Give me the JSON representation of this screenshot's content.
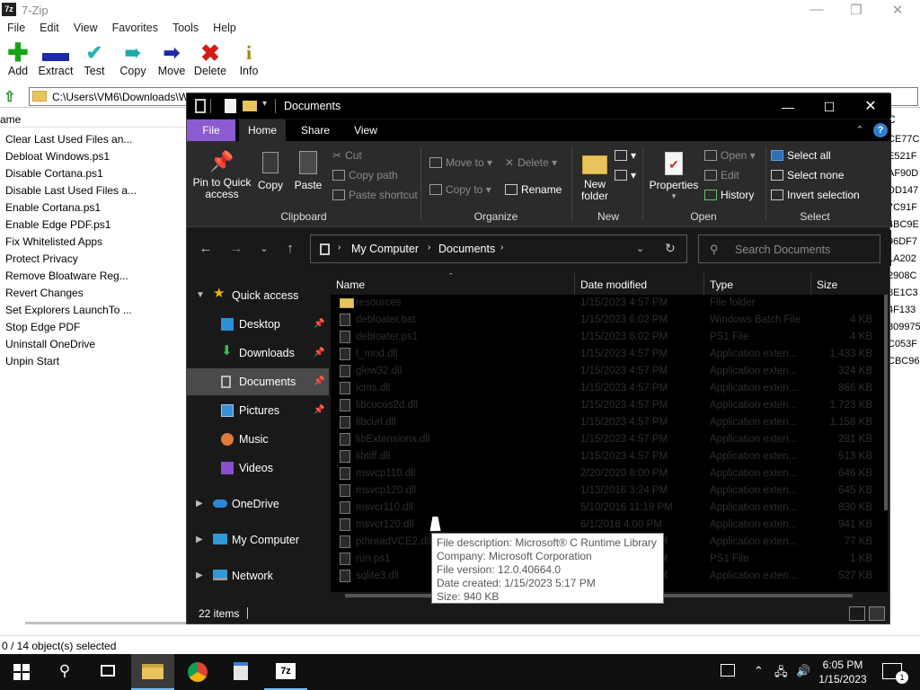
{
  "zip": {
    "title": "7-Zip",
    "menu": [
      "File",
      "Edit",
      "View",
      "Favorites",
      "Tools",
      "Help"
    ],
    "toolbar": [
      {
        "label": "Add",
        "icon": "plus-icon",
        "color": "#17a317"
      },
      {
        "label": "Extract",
        "icon": "minus-icon",
        "color": "#1a2aa8"
      },
      {
        "label": "Test",
        "icon": "check-icon",
        "color": "#1fb5b5"
      },
      {
        "label": "Copy",
        "icon": "double-arrow-icon",
        "color": "#1aa8a8"
      },
      {
        "label": "Move",
        "icon": "arrow-right-icon",
        "color": "#1a2aa8"
      },
      {
        "label": "Delete",
        "icon": "x-icon",
        "color": "#d41a1a"
      },
      {
        "label": "Info",
        "icon": "info-icon",
        "color": "#a08a10"
      }
    ],
    "address": "C:\\Users\\VM6\\Downloads\\W",
    "column_name": "ame",
    "files": [
      "Clear Last Used Files an...",
      "Debloat Windows.ps1",
      "Disable Cortana.ps1",
      "Disable Last Used Files a...",
      "Enable Cortana.ps1",
      "Enable Edge PDF.ps1",
      "Fix Whitelisted Apps",
      "Protect Privacy",
      "Remove Bloatware Reg...",
      "Revert Changes",
      "Set Explorers LaunchTo ...",
      "Stop Edge PDF",
      "Uninstall OneDrive",
      "Unpin Start"
    ],
    "right_col_header": "C",
    "right_col": [
      "CE77C",
      "E521F",
      "AF90D",
      "DD147",
      "7C91F",
      "4BC9E",
      "96DF7",
      "1A202",
      "2908C",
      "8E1C3",
      "4F133",
      "309975",
      "C053F",
      "CBC96"
    ],
    "status": "0 / 14 object(s) selected"
  },
  "explorer": {
    "title": "Documents",
    "tabs": [
      "File",
      "Home",
      "Share",
      "View"
    ],
    "ribbon": {
      "pin": "Pin to Quick access",
      "copy": "Copy",
      "paste": "Paste",
      "cut": "Cut",
      "copy_path": "Copy path",
      "paste_shortcut": "Paste shortcut",
      "clipboard": "Clipboard",
      "move_to": "Move to",
      "copy_to": "Copy to",
      "delete": "Delete",
      "rename": "Rename",
      "organize": "Organize",
      "new_folder": "New folder",
      "new": "New",
      "properties": "Properties",
      "open": "Open",
      "edit": "Edit",
      "history": "History",
      "open_group": "Open",
      "select_all": "Select all",
      "select_none": "Select none",
      "invert": "Invert selection",
      "select": "Select"
    },
    "breadcrumb": [
      "My Computer",
      "Documents"
    ],
    "search_placeholder": "Search Documents",
    "nav": [
      {
        "label": "Quick access",
        "icon": "star-icon"
      },
      {
        "label": "Desktop",
        "icon": "desktop-icon"
      },
      {
        "label": "Downloads",
        "icon": "download-icon"
      },
      {
        "label": "Documents",
        "icon": "documents-icon"
      },
      {
        "label": "Pictures",
        "icon": "pictures-icon"
      },
      {
        "label": "Music",
        "icon": "music-icon"
      },
      {
        "label": "Videos",
        "icon": "videos-icon"
      },
      {
        "label": "OneDrive",
        "icon": "cloud-icon"
      },
      {
        "label": "My Computer",
        "icon": "computer-icon"
      },
      {
        "label": "Network",
        "icon": "network-icon"
      }
    ],
    "columns": [
      "Name",
      "Date modified",
      "Type",
      "Size"
    ],
    "files": [
      {
        "name": "resources",
        "date": "1/15/2023 4:57 PM",
        "type": "File folder",
        "size": "",
        "folder": true
      },
      {
        "name": "debloater.bat",
        "date": "1/15/2023 6:02 PM",
        "type": "Windows Batch File",
        "size": "4 KB"
      },
      {
        "name": "debloater.ps1",
        "date": "1/15/2023 6:02 PM",
        "type": "PS1 File",
        "size": "4 KB"
      },
      {
        "name": "f_mod.dll",
        "date": "1/15/2023 4:57 PM",
        "type": "Application exten...",
        "size": "1,433 KB"
      },
      {
        "name": "glew32.dll",
        "date": "1/15/2023 4:57 PM",
        "type": "Application exten...",
        "size": "324 KB"
      },
      {
        "name": "lcms.dll",
        "date": "1/15/2023 4:57 PM",
        "type": "Application exten...",
        "size": "866 KB"
      },
      {
        "name": "libcocos2d.dll",
        "date": "1/15/2023 4:57 PM",
        "type": "Application exten...",
        "size": "1,723 KB"
      },
      {
        "name": "libcurl.dll",
        "date": "1/15/2023 4:57 PM",
        "type": "Application exten...",
        "size": "1,158 KB"
      },
      {
        "name": "libExtensions.dll",
        "date": "1/15/2023 4:57 PM",
        "type": "Application exten...",
        "size": "281 KB"
      },
      {
        "name": "libtiff.dll",
        "date": "1/15/2023 4:57 PM",
        "type": "Application exten...",
        "size": "513 KB"
      },
      {
        "name": "msvcp110.dll",
        "date": "2/20/2020 8:00 PM",
        "type": "Application exten...",
        "size": "646 KB"
      },
      {
        "name": "msvcp120.dll",
        "date": "1/13/2016 3:24 PM",
        "type": "Application exten...",
        "size": "645 KB"
      },
      {
        "name": "msvcr110.dll",
        "date": "5/10/2016 11:19 PM",
        "type": "Application exten...",
        "size": "830 KB"
      },
      {
        "name": "msvcr120.dll",
        "date": "6/1/2018 4:00 PM",
        "type": "Application exten...",
        "size": "941 KB"
      },
      {
        "name": "pthreadVCE2.dll",
        "date": "1/15/2023 4:57 PM",
        "type": "Application exten...",
        "size": "77 KB"
      },
      {
        "name": "run.ps1",
        "date": "1/15/2023 4:57 PM",
        "type": "PS1 File",
        "size": "1 KB"
      },
      {
        "name": "sqlite3.dll",
        "date": "1/15/2023 4:57 PM",
        "type": "Application exten...",
        "size": "527 KB"
      }
    ],
    "status": "22 items"
  },
  "tooltip": [
    "File description: Microsoft® C Runtime Library",
    "Company: Microsoft Corporation",
    "File version: 12.0.40664.0",
    "Date created: 1/15/2023 5:17 PM",
    "Size: 940 KB"
  ],
  "taskbar": {
    "time": "6:05 PM",
    "date": "1/15/2023",
    "notifications": "1"
  },
  "colors": {
    "accent_file_tab": "#8a5cd0",
    "ribbon_bg": "#2b2b2b",
    "explorer_bg": "#191919",
    "taskbar_bg": "#101010"
  }
}
